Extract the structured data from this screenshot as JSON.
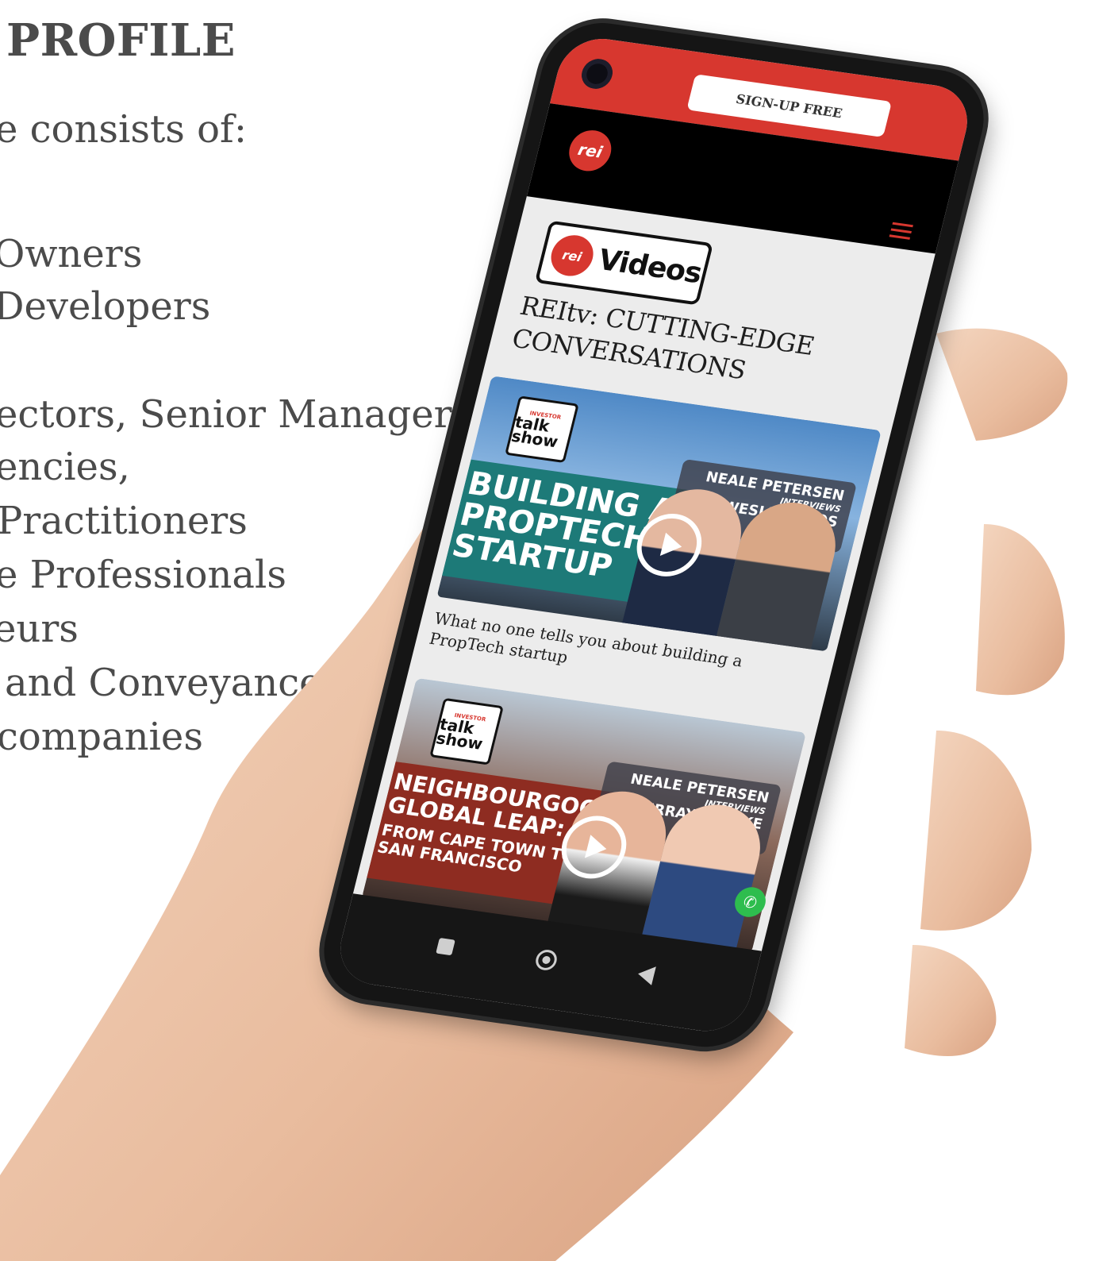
{
  "profile": {
    "heading": "PROFILE",
    "intro": "e consists of:",
    "items": [
      "Owners",
      "Developers",
      "ectors, Senior Managers",
      "encies,",
      "Practitioners",
      "e Professionals",
      "eurs",
      "and Conveyancers",
      "companies"
    ]
  },
  "phone": {
    "signup_label": "SIGN-UP FREE",
    "logo_text": "rei",
    "videos_badge": {
      "logo_text": "rei",
      "label": "Videos"
    },
    "section_title": "REItv: CUTTING-EDGE CONVERSATIONS",
    "cards": [
      {
        "talkshow_top": "INVESTOR",
        "talkshow_main": "talk show",
        "banner": "BUILDING A PROPTECH STARTUP",
        "host": "NEALE PETERSEN",
        "interviews": "INTERVIEWS",
        "guest": "WESLEY ROOS",
        "caption": "What no one tells you about building a PropTech startup"
      },
      {
        "talkshow_top": "INVESTOR",
        "talkshow_main": "talk show",
        "banner": "NEIGHBOURGOOD'S GLOBAL LEAP:",
        "banner_sub": "FROM CAPE TOWN TO SAN FRANCISCO",
        "host": "NEALE PETERSEN",
        "interviews": "INTERVIEWS",
        "guest": "MURRAY CLARKE"
      }
    ]
  },
  "colors": {
    "brand_red": "#d7372f",
    "text_gray": "#4b4b4b",
    "skin": "#efc9ad",
    "whatsapp": "#2ebd4e"
  }
}
